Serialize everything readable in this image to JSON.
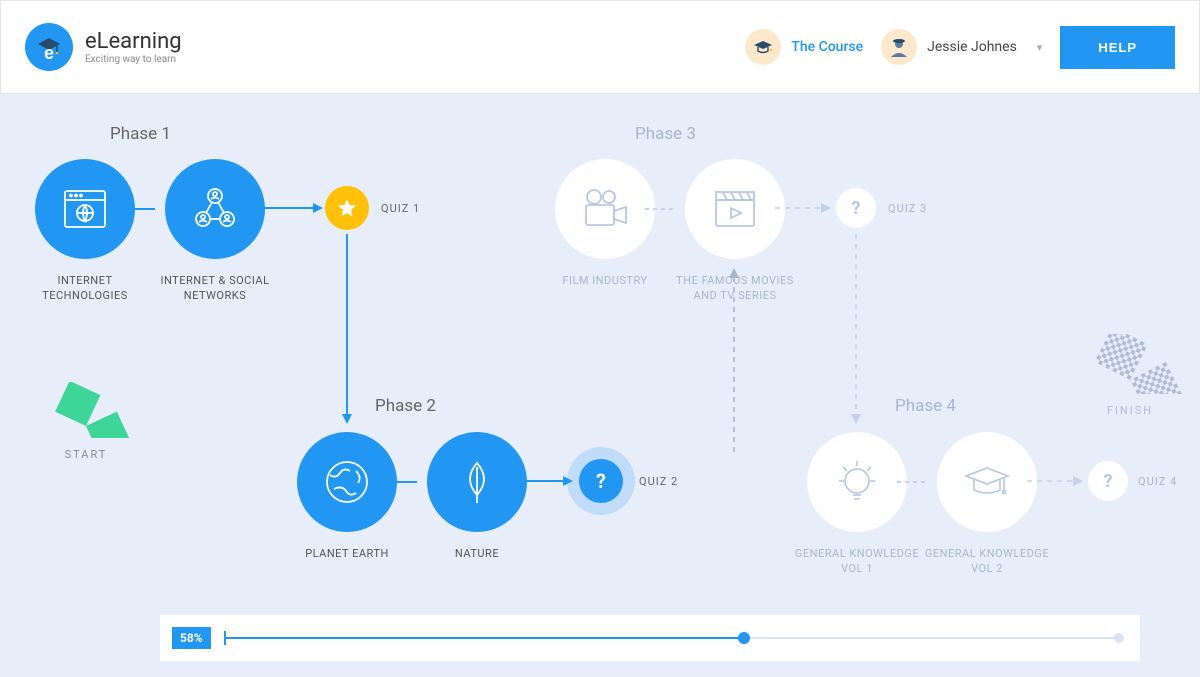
{
  "brand": {
    "title": "eLearning",
    "subtitle": "Exciting way to learn"
  },
  "header": {
    "course_link": "The Course",
    "user_name": "Jessie Johnes",
    "help": "HELP"
  },
  "phases": {
    "p1": "Phase 1",
    "p2": "Phase 2",
    "p3": "Phase 3",
    "p4": "Phase 4"
  },
  "nodes": {
    "p1n1": "INTERNET TECHNOLOGIES",
    "p1n2": "INTERNET & SOCIAL NETWORKS",
    "q1": "QUIZ 1",
    "p2n1": "PLANET EARTH",
    "p2n2": "NATURE",
    "q2": "QUIZ 2",
    "p3n1": "FILM INDUSTRY",
    "p3n2": "THE FAMOUS MOVIES AND TV SERIES",
    "q3": "QUIZ 3",
    "p4n1": "GENERAL KNOWLEDGE VOL 1",
    "p4n2": "GENERAL KNOWLEDGE VOL 2",
    "q4": "QUIZ 4"
  },
  "markers": {
    "start": "START",
    "finish": "FINISH"
  },
  "progress": {
    "percent": "58%",
    "value": 58
  }
}
